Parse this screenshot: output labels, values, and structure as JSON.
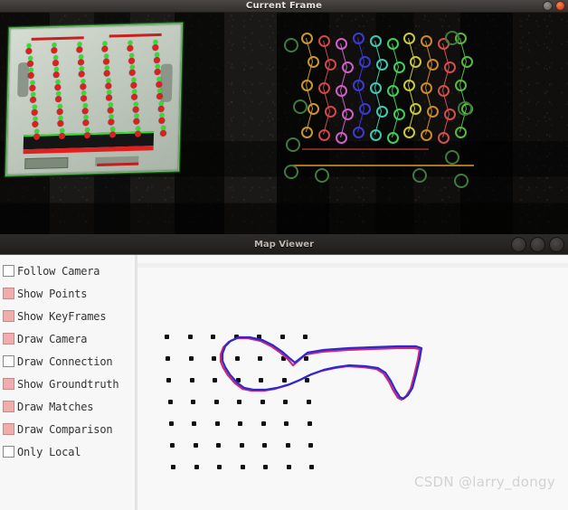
{
  "windows": {
    "current_frame": {
      "title": "Current Frame",
      "buttons": [
        {
          "name": "minimize-button",
          "icon": "minimize-icon"
        },
        {
          "name": "close-button",
          "icon": "close-icon"
        }
      ]
    },
    "map_viewer": {
      "title": "Map Viewer",
      "buttons": [
        {
          "name": "map-viewer-button-1",
          "icon": "circle-icon"
        },
        {
          "name": "map-viewer-button-2",
          "icon": "circle-icon"
        },
        {
          "name": "map-viewer-button-3",
          "icon": "circle-icon"
        }
      ]
    }
  },
  "controls": {
    "checkboxes": [
      {
        "label": "Follow Camera",
        "checked": false,
        "name": "checkbox-follow-camera"
      },
      {
        "label": "Show Points",
        "checked": true,
        "name": "checkbox-show-points"
      },
      {
        "label": "Show KeyFrames",
        "checked": true,
        "name": "checkbox-show-keyframes"
      },
      {
        "label": "Draw Camera",
        "checked": true,
        "name": "checkbox-draw-camera"
      },
      {
        "label": "Draw Connection",
        "checked": false,
        "name": "checkbox-draw-connection"
      },
      {
        "label": "Show Groundtruth",
        "checked": true,
        "name": "checkbox-show-groundtruth"
      },
      {
        "label": "Draw Matches",
        "checked": true,
        "name": "checkbox-draw-matches"
      },
      {
        "label": "Draw Comparison",
        "checked": true,
        "name": "checkbox-draw-comparison"
      },
      {
        "label": "Only Local",
        "checked": false,
        "name": "checkbox-only-local"
      }
    ]
  },
  "map": {
    "watermark": "CSDN @larry_dongy",
    "estimated_trajectory_color": "#2a2ad0",
    "groundtruth_trajectory_color": "#d02878",
    "map_point_color": "#111111"
  },
  "frames": {
    "left": {
      "keypoint_color": "#d62222",
      "edge_color": "#2ee02e"
    },
    "right": {
      "match_colors": [
        "#c9962b",
        "#d04848",
        "#cf5fc8",
        "#3a3ad0",
        "#3fc9b0",
        "#3fcf5a",
        "#c9c93b",
        "#c98a2b",
        "#d05050",
        "#57b83f"
      ]
    }
  }
}
